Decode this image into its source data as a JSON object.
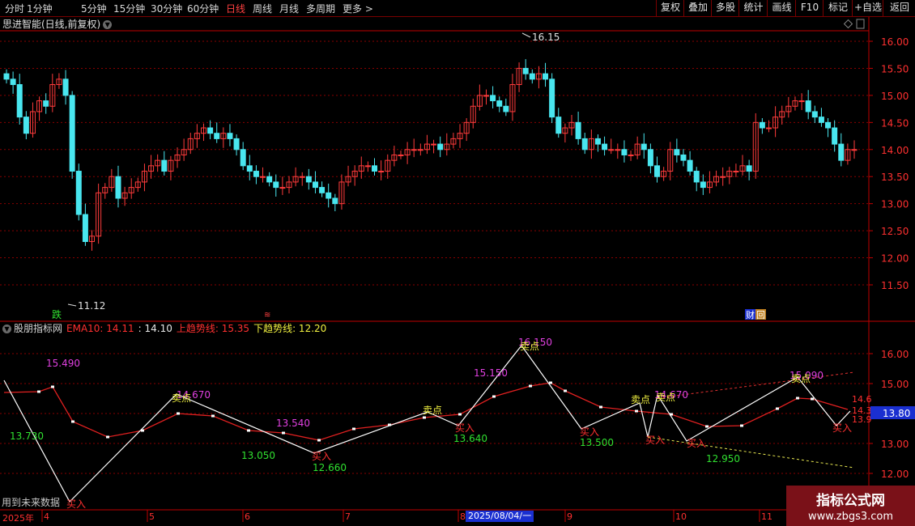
{
  "toolbar": {
    "periods": [
      "分时",
      "1分钟",
      "5分钟",
      "15分钟",
      "30分钟",
      "60分钟",
      "日线",
      "周线",
      "月线",
      "多周期",
      "更多"
    ],
    "active": "日线",
    "more_arrow": ">",
    "right_buttons": [
      "复权",
      "叠加",
      "多股",
      "统计",
      "画线",
      "F10",
      "标记",
      "+自选",
      "返回"
    ]
  },
  "price_panel": {
    "title": "思进智能(日线,前复权)",
    "high_label": "16.15",
    "low_label": "11.12",
    "y_ticks": [
      "16.00",
      "15.50",
      "15.00",
      "14.50",
      "14.00",
      "13.50",
      "13.00",
      "12.50",
      "12.00",
      "11.50"
    ],
    "markers": {
      "die": "跌",
      "small": "≋",
      "cai": "财",
      "hui": "回"
    }
  },
  "indicator_panel": {
    "name": "股朋指标网",
    "ema_label": "EMA10: 14.11",
    "ema_value": ": 14.10",
    "upper_label": "上趋势线: 15.35",
    "lower_label": "下趋势线: 12.20",
    "y_ticks": [
      "16.00",
      "15.00",
      "14.00",
      "13.00",
      "12.00"
    ],
    "current_value": "13.80",
    "right_values": [
      "14.6",
      "14.3",
      "13.9"
    ],
    "footer_note": "用到未来数据",
    "peak_values": [
      "15.490",
      "14.670",
      "13.540",
      "15.150",
      "16.150",
      "14.670",
      "15.090"
    ],
    "trough_values": [
      "13.730",
      "13.050",
      "12.660",
      "13.640",
      "13.500",
      "12.950"
    ],
    "buy_label": "买入",
    "sell_label": "卖点"
  },
  "x_axis": {
    "year": "2025年",
    "months": [
      "4",
      "5",
      "6",
      "7",
      "8",
      "9",
      "10",
      "11"
    ],
    "cursor_date": "2025/08/04/一"
  },
  "watermark": {
    "title": "指标公式网",
    "url": "www.zbgs3.com"
  },
  "colors": {
    "up": "#ff3b3b",
    "down": "#49e6ef",
    "ema": "#e02020",
    "zigzag": "#ffffff",
    "upper": "#e03030",
    "lower": "#e8e850",
    "magenta": "#e040e0",
    "green": "#30e030",
    "grid": "#8a0000",
    "axis": "#c00000"
  }
}
